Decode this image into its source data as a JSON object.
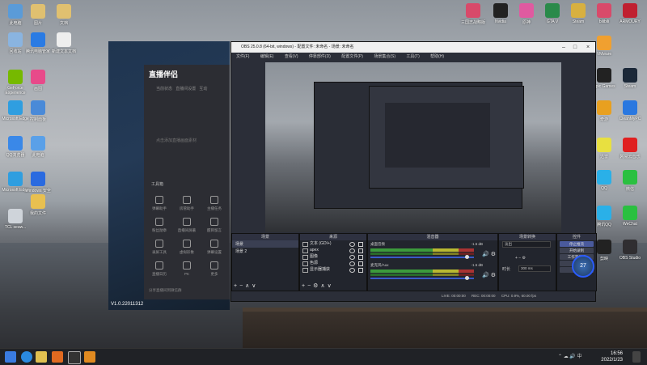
{
  "desktop": {
    "icons_left": [
      {
        "label": "此电脑",
        "color": "#5a9bd8"
      },
      {
        "label": "图片",
        "color": "#e0c070"
      },
      {
        "label": "文档",
        "color": "#e0c070"
      },
      {
        "label": "回收站",
        "color": "#8ab4e0"
      },
      {
        "label": "腾讯电脑管家",
        "color": "#2a7be4"
      },
      {
        "label": "新建文本文档",
        "color": "#eeeeee"
      },
      {
        "label": "GeForce Experience",
        "color": "#76b900"
      },
      {
        "label": "画图",
        "color": "#e84a8a"
      },
      {
        "label": "Microsoft Edge",
        "color": "#2f9ee0"
      },
      {
        "label": "控制面板",
        "color": "#4a8ad8"
      },
      {
        "label": "QQ浏览器",
        "color": "#3a88e8"
      },
      {
        "label": "此电脑",
        "color": "#5aa0e8"
      },
      {
        "label": "Microsoft Edge",
        "color": "#2f9ee0"
      },
      {
        "label": "Windows 安全",
        "color": "#2a6ae0"
      },
      {
        "label": "我的文件",
        "color": "#e8c050"
      },
      {
        "label": "TCL seaw...",
        "color": "#cfd4da"
      }
    ],
    "icons_top": [
      {
        "label": "三国志战略版",
        "color": "#d84a6a"
      },
      {
        "label": "Nvidia",
        "color": "#222222"
      },
      {
        "label": "原神",
        "color": "#e05aa0"
      },
      {
        "label": "GTA V",
        "color": "#2a8a4a"
      },
      {
        "label": "Steam",
        "color": "#d8b040"
      },
      {
        "label": "bilibili",
        "color": "#d84a6a"
      },
      {
        "label": "ARMOURY",
        "color": "#c02030"
      }
    ],
    "icons_right": [
      {
        "label": "VMware",
        "color": "#f0a030"
      },
      {
        "label": "Epic Games",
        "color": "#222222"
      },
      {
        "label": "Steam",
        "color": "#1b2838"
      },
      {
        "label": "奇游",
        "color": "#e8a020"
      },
      {
        "label": "CleanMyPC",
        "color": "#2a78e0"
      },
      {
        "label": "迅雷",
        "color": "#e8e040"
      },
      {
        "label": "网易云音乐",
        "color": "#e02020"
      },
      {
        "label": "QQ",
        "color": "#2ab0e8"
      },
      {
        "label": "微信",
        "color": "#2ac040"
      },
      {
        "label": "腾讯QQ",
        "color": "#2ab0e8"
      },
      {
        "label": "WeChat",
        "color": "#2ac040"
      },
      {
        "label": "剪映",
        "color": "#222222"
      },
      {
        "label": "OBS Studio",
        "color": "#302e31"
      }
    ]
  },
  "livehime": {
    "logo": "直播伴侣",
    "tabs": [
      "当前状态",
      "直播间设置",
      "互动"
    ],
    "empty_hint": "点击添加直播画面素材",
    "tools_title": "工具箱",
    "tools": [
      "弹幕助手",
      "房管助手",
      "主播任务",
      "粉丝勋章",
      "直播间屏蔽",
      "醒目留言",
      "录屏工具",
      "虚拟形象",
      "弹幕设置",
      "直播日历",
      "PK",
      "更多"
    ],
    "footer": "分享直播间到微信群",
    "version": "V1.0.22011312"
  },
  "obs": {
    "title": "OBS 25.0.8 (64-bit, windows) - 配置文件: 未命名 - 场景: 未命名",
    "menu": [
      "文件(F)",
      "编辑(E)",
      "查看(V)",
      "停靠部件(D)",
      "配置文件(P)",
      "场景集合(S)",
      "工具(T)",
      "帮助(H)"
    ],
    "docks": {
      "scenes_title": "场景",
      "scenes": [
        "场景",
        "场景 2"
      ],
      "sources_title": "来源",
      "sources": [
        "文本 (GDI+)",
        "apex",
        "图像",
        "色源",
        "显示器捕获"
      ],
      "mixer_title": "混音器",
      "mixer": [
        {
          "name": "桌面音频",
          "db": "-1.5 dB"
        },
        {
          "name": "麦克风/Aux",
          "db": "-1.5 dB"
        }
      ],
      "transitions_title": "场景转换",
      "transition_type": "淡出",
      "duration_label": "时长",
      "duration_value": "300 ms",
      "controls_title": "控件",
      "controls": [
        "停止推流",
        "开始录制",
        "工作室模式",
        "设置",
        "退出"
      ]
    },
    "status": {
      "live": "LIVE: 00:00:00",
      "rec": "REC: 00:00:00",
      "cpu": "CPU: 0.9%, 60.00 fps"
    }
  },
  "speed_widget": "27",
  "taskbar": {
    "time": "16:56",
    "date": "2022/1/23"
  }
}
